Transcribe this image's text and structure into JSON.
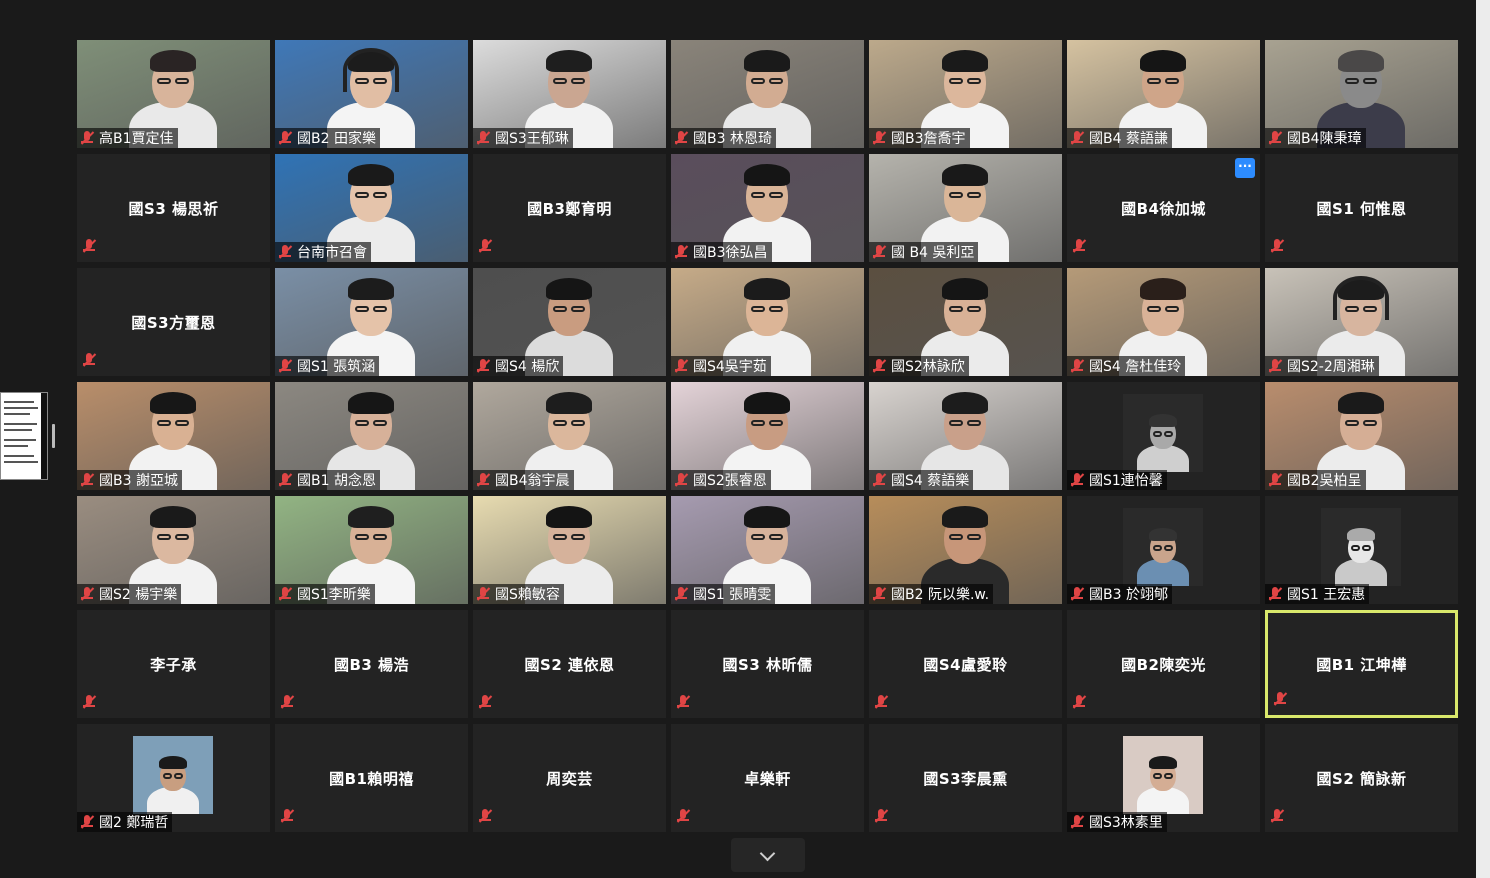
{
  "window": {
    "background": "#1a1a1a",
    "mute_color": "#e04545",
    "active_speaker_color": "#d9e86b",
    "more_button_color": "#2d8cff",
    "more_button_label": "···"
  },
  "rows": [
    [
      {
        "name": "高B1賈定佳",
        "video": true,
        "bg": "#7f8f78",
        "skin": "#d8b49b",
        "hair": "#2a2424",
        "shirt": "#e9e9e9"
      },
      {
        "name": "國B2 田家樂",
        "video": true,
        "bg": "#3f78b8",
        "skin": "#e1bea4",
        "hair": "#1c1c1c",
        "shirt": "#f4f4f4",
        "headset": true
      },
      {
        "name": "國S3王郁琳",
        "video": true,
        "bg": "#dcdcdc",
        "skin": "#caa691",
        "hair": "#1e1e1e",
        "shirt": "#f2f2f2"
      },
      {
        "name": "國B3 林恩琦",
        "video": true,
        "bg": "#8a847a",
        "skin": "#d2ac92",
        "hair": "#1a1a1a",
        "shirt": "#e8e8e8"
      },
      {
        "name": "國B3詹喬宇",
        "video": true,
        "bg": "#bca98b",
        "skin": "#dcb79c",
        "hair": "#1a1a1a",
        "shirt": "#f3f3f3"
      },
      {
        "name": "國B4 蔡語謙",
        "video": true,
        "bg": "#d5c2a0",
        "skin": "#cfa589",
        "hair": "#151515",
        "shirt": "#f2f2f2"
      },
      {
        "name": "國B4陳秉璋",
        "video": true,
        "bg": "#a8a291",
        "skin": "#8a8a8a",
        "hair": "#4a4848",
        "shirt": "#3c3c4a"
      }
    ],
    [
      {
        "name": "國S3 楊思祈",
        "video": false
      },
      {
        "name": "台南市召會",
        "video": true,
        "bg": "#2f73b6",
        "skin": "#e5c4ab",
        "hair": "#1a1a1a",
        "shirt": "#ececec"
      },
      {
        "name": "國B3鄭育明",
        "video": false
      },
      {
        "name": "國B3徐弘昌",
        "video": true,
        "bg": "#5a4d5c",
        "skin": "#d9b497",
        "hair": "#151515",
        "shirt": "#f2f2f2"
      },
      {
        "name": "國 B4 吳利亞",
        "video": true,
        "bg": "#b5b3ac",
        "skin": "#dab698",
        "hair": "#191919",
        "shirt": "#f2f2f2"
      },
      {
        "name": "國B4徐加城",
        "video": false,
        "more": true
      },
      {
        "name": "國S1 何惟恩",
        "video": false
      }
    ],
    [
      {
        "name": "國S3方璽恩",
        "video": false
      },
      {
        "name": "國S1 張筑涵",
        "video": true,
        "bg": "#7a8fa6",
        "skin": "#e5c3a9",
        "hair": "#1c1c1c",
        "shirt": "#f4f4f4"
      },
      {
        "name": "國S4 楊欣",
        "video": true,
        "bg": "#4e4e4e",
        "skin": "#c99c80",
        "hair": "#151515",
        "shirt": "#dcdcdc"
      },
      {
        "name": "國S4吳宇茹",
        "video": true,
        "bg": "#c6ab88",
        "skin": "#dcb597",
        "hair": "#1b1b1b",
        "shirt": "#f0f0f0"
      },
      {
        "name": "國S2林詠欣",
        "video": true,
        "bg": "#5b4f40",
        "skin": "#d8b196",
        "hair": "#151515",
        "shirt": "#ebebeb"
      },
      {
        "name": "國S4 詹杜佳玲",
        "video": true,
        "bg": "#b59a78",
        "skin": "#d9b297",
        "hair": "#2a1f1a",
        "shirt": "#f0f0f0"
      },
      {
        "name": "國S2-2周湘琳",
        "video": true,
        "bg": "#c8c2b8",
        "skin": "#d7b59f",
        "hair": "#1c1c1c",
        "shirt": "#ebebeb",
        "headset": true
      }
    ],
    [
      {
        "name": "國B3 謝亞城",
        "video": true,
        "bg": "#b98e6a",
        "skin": "#d9b193",
        "hair": "#171717",
        "shirt": "#f2f2f2"
      },
      {
        "name": "國B1 胡念恩",
        "video": true,
        "bg": "#8c8881",
        "skin": "#d7b199",
        "hair": "#161616",
        "shirt": "#e6e6e6"
      },
      {
        "name": "國B4翁宇晨",
        "video": true,
        "bg": "#b0a89d",
        "skin": "#dbb79c",
        "hair": "#1d1d1d",
        "shirt": "#efefef"
      },
      {
        "name": "國S2張睿恩",
        "video": true,
        "bg": "#e4d3d8",
        "skin": "#c89c82",
        "hair": "#141414",
        "shirt": "#f3f3f3"
      },
      {
        "name": "國S4 蔡語樂",
        "video": true,
        "bg": "#d8d3cf",
        "skin": "#c9a08a",
        "hair": "#1c1c1c",
        "shirt": "#e6e6e6"
      },
      {
        "name": "國S1連怡馨",
        "video": true,
        "bg": "#2a2a2a",
        "skin": "#a9a9a9",
        "hair": "#333",
        "shirt": "#cfcfcf",
        "small": true
      },
      {
        "name": "國B2吳柏呈",
        "video": true,
        "bg": "#b98d6d",
        "skin": "#d5ae95",
        "hair": "#1a1a1a",
        "shirt": "#ececec"
      }
    ],
    [
      {
        "name": "國S2 楊宇樂",
        "video": true,
        "bg": "#9a8d80",
        "skin": "#dbb8a0",
        "hair": "#1a1a1a",
        "shirt": "#f2f2f2"
      },
      {
        "name": "國S1李昕樂",
        "video": true,
        "bg": "#92b483",
        "skin": "#d8b196",
        "hair": "#1f1f1f",
        "shirt": "#f4f4f4"
      },
      {
        "name": "國S賴敏容",
        "video": true,
        "bg": "#e7dbb0",
        "skin": "#d6b29b",
        "hair": "#141414",
        "shirt": "#ececec"
      },
      {
        "name": "國S1 張晴雯",
        "video": true,
        "bg": "#a69bb0",
        "skin": "#d7b39c",
        "hair": "#161616",
        "shirt": "#f4f4f4"
      },
      {
        "name": "國B2 阮以樂.w.",
        "video": true,
        "bg": "#b78d5a",
        "skin": "#c79679",
        "hair": "#1a1a1a",
        "shirt": "#2a2a2a"
      },
      {
        "name": "國B3 於翊郇",
        "video": true,
        "bg": "#2a2a2a",
        "skin": "#c9a48c",
        "hair": "#333",
        "shirt": "#6b8fb2",
        "small": true
      },
      {
        "name": "國S1 王宏惠",
        "video": true,
        "bg": "#2a2a2a",
        "skin": "#e7e7e7",
        "hair": "#aaa",
        "shirt": "#c9c9c9",
        "small": true
      }
    ],
    [
      {
        "name": "李子承",
        "video": false
      },
      {
        "name": "國B3 楊浩",
        "video": false
      },
      {
        "name": "國S2 連依恩",
        "video": false
      },
      {
        "name": "國S3 林昕儒",
        "video": false
      },
      {
        "name": "國S4盧愛聆",
        "video": false
      },
      {
        "name": "國B2陳奕光",
        "video": false
      },
      {
        "name": "國B1 江坤樺",
        "video": false,
        "active": true
      }
    ],
    [
      {
        "name": "國2 鄭瑞哲",
        "video": false,
        "photo": true,
        "photo_bg": "#7e9fb8",
        "photo_skin": "#c89e80",
        "photo_shirt": "#f0f0f0"
      },
      {
        "name": "國B1賴明禧",
        "video": false
      },
      {
        "name": "周奕芸",
        "video": false
      },
      {
        "name": "卓樂軒",
        "video": false
      },
      {
        "name": "國S3李晨熏",
        "video": false
      },
      {
        "name": "國S3林素里",
        "video": false,
        "photo": true,
        "photo_bg": "#d9cbc4",
        "photo_skin": "#d4ad94",
        "photo_shirt": "#f4f4f4"
      },
      {
        "name": "國S2 簡詠新",
        "video": false
      }
    ]
  ]
}
